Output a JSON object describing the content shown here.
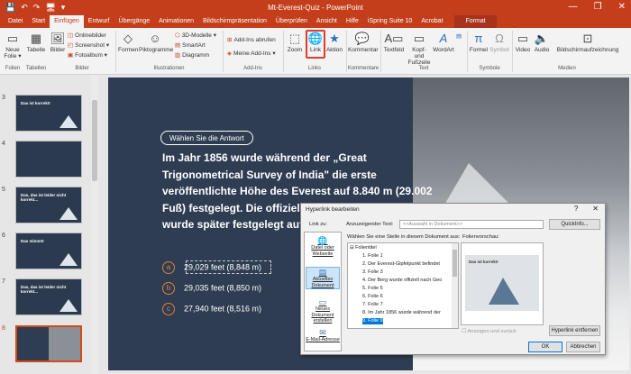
{
  "window": {
    "title": "Mt-Everest-Quiz - PowerPoint",
    "quick_access": [
      "💾",
      "↶",
      "↷",
      "🖥",
      "▾"
    ],
    "controls": [
      "—",
      "❐",
      "✕"
    ]
  },
  "tabs": [
    "Datei",
    "Start",
    "Einfügen",
    "Entwurf",
    "Übergänge",
    "Animationen",
    "Bildschirmpräsentation",
    "Überprüfen",
    "Ansicht",
    "Hilfe",
    "iSpring Suite 10",
    "Acrobat",
    "Format"
  ],
  "active_tab": "Einfügen",
  "ribbon": {
    "neue_folie": "Neue Folie ▾",
    "tabelle": "Tabelle",
    "bilder": "Bilder",
    "onlinebilder": "Onlinebilder",
    "screenshot": "Screenshot ▾",
    "fotoalbum": "Fotoalbum ▾",
    "formen": "Formen",
    "piktogramme": "Piktogramme",
    "modelle3d": "3D-Modelle ▾",
    "smartart": "SmartArt",
    "diagramm": "Diagramm",
    "addins_abrufen": "Add-Ins abrufen",
    "meine_addins": "Meine Add-Ins ▾",
    "zoom": "Zoom",
    "link": "Link",
    "aktion": "Aktion",
    "kommentar": "Kommentar",
    "textfeld": "Textfeld",
    "kopf_fuss": "Kopf- und Fußzeile",
    "wordart": "WordArt",
    "formel": "Formel",
    "symbol": "Symbol",
    "video": "Video",
    "audio": "Audio",
    "bildschirmaufzeichnung": "Bildschirmaufzeichnung",
    "groups": [
      "Folien",
      "Tabellen",
      "Bilder",
      "Illustrationen",
      "Add-Ins",
      "Links",
      "Kommentare",
      "Text",
      "Symbole",
      "Medien"
    ]
  },
  "thumbnails": [
    {
      "num": "3",
      "title": "Das ist korrekt!"
    },
    {
      "num": "4",
      "title": ""
    },
    {
      "num": "5",
      "title": "Das, das ist leider nicht korrekt..."
    },
    {
      "num": "6",
      "title": "Das stimmt!"
    },
    {
      "num": "7",
      "title": "Das, das ist leider nicht korrekt..."
    },
    {
      "num": "8",
      "title": ""
    }
  ],
  "slide": {
    "pill": "Wählen Sie die Antwort",
    "question": "Im Jahr 1856 wurde während der „Great Trigonometrical Survey of India\" die erste veröffentlichte Höhe des Everest auf 8.840 m (29.002 Fuß) festgelegt. Die offizielle Höhe des Everest wurde später festgelegt auf...",
    "answers": [
      {
        "letter": "a",
        "text": "29,029 feet (8,848 m)"
      },
      {
        "letter": "b",
        "text": "29,035 feet (8,850 m)"
      },
      {
        "letter": "c",
        "text": "27,940 feet (8,516 m)"
      }
    ]
  },
  "dialog": {
    "title": "Hyperlink bearbeiten",
    "help": "?",
    "close": "✕",
    "link_to_label": "Link zu:",
    "link_to": [
      "Datei oder Webseite",
      "Aktuelles Dokument",
      "Neues Dokument erstellen",
      "E-Mail-Adresse"
    ],
    "anzeige_label": "Anzuzeigender Text:",
    "anzeige_value": "<<Auswahl in Dokument>>",
    "quickinfo": "QuickInfo...",
    "stelle_label": "Wählen Sie eine Stelle in diesem Dokument aus:",
    "vorschau_label": "Folienvorschau:",
    "tree_root": "Folientitel",
    "tree_items": [
      "1. Folie 1",
      "2. Der Everest-Gipfelpunkt befindet",
      "3. Folie 3",
      "4. Der Berg wurde offiziell nach Geo",
      "5. Folie 5",
      "6. Folie 6",
      "7. Folie 7",
      "8. Im Jahr 1856 wurde während der",
      "9. Folie 9"
    ],
    "selected_item": "9. Folie 9",
    "preview_title": "Das ist korrekt!",
    "anzeigen": "Anzeigen und zurück",
    "remove": "Hyperlink entfernen",
    "ok": "OK",
    "cancel": "Abbrechen"
  }
}
